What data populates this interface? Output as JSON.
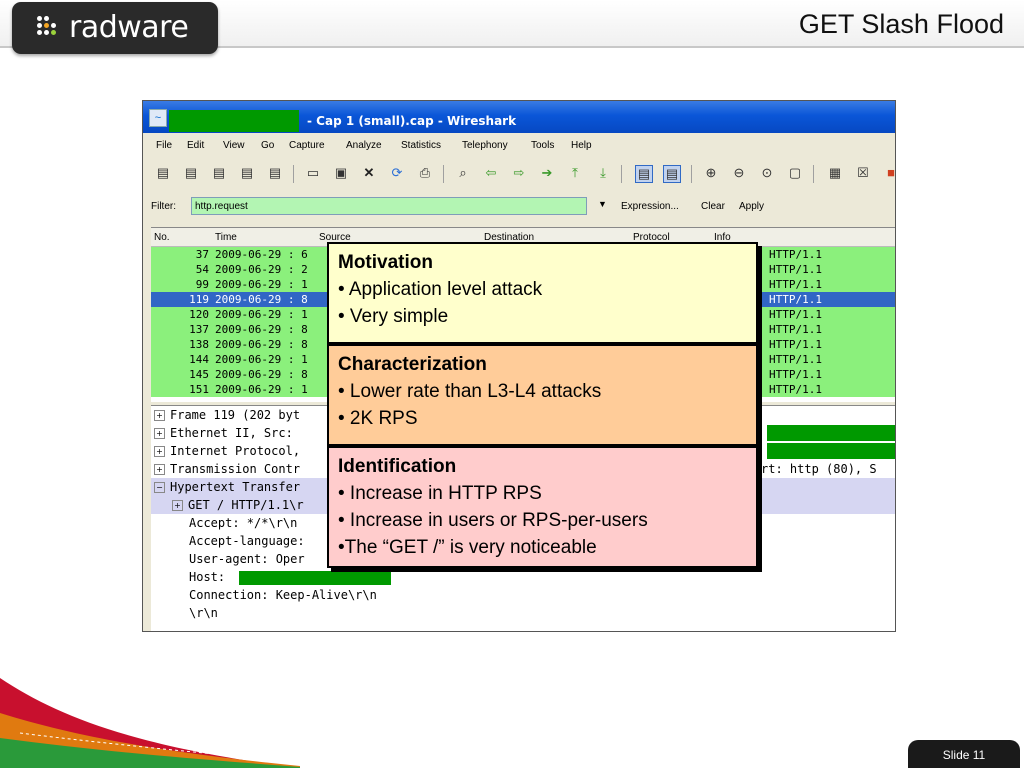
{
  "header": {
    "logo_text": "radware",
    "slide_title": "GET Slash Flood"
  },
  "wireshark": {
    "title": "- Cap 1 (small).cap - Wireshark",
    "menu": [
      "File",
      "Edit",
      "View",
      "Go",
      "Capture",
      "Analyze",
      "Statistics",
      "Telephony",
      "Tools",
      "Help"
    ],
    "filter_label": "Filter:",
    "filter_value": "http.request",
    "expression_label": "Expression...",
    "clear_label": "Clear",
    "apply_label": "Apply",
    "columns": [
      "No.",
      "Time",
      "Source",
      "Destination",
      "Protocol",
      "Info"
    ],
    "packets": [
      {
        "no": "37",
        "time": "2009-06-29 : 6",
        "info": "HTTP/1.1"
      },
      {
        "no": "54",
        "time": "2009-06-29 : 2",
        "info": "HTTP/1.1"
      },
      {
        "no": "99",
        "time": "2009-06-29 : 1",
        "info": "HTTP/1.1"
      },
      {
        "no": "119",
        "time": "2009-06-29 : 8",
        "info": "HTTP/1.1"
      },
      {
        "no": "120",
        "time": "2009-06-29 : 1",
        "info": "HTTP/1.1"
      },
      {
        "no": "137",
        "time": "2009-06-29 : 8",
        "info": "HTTP/1.1"
      },
      {
        "no": "138",
        "time": "2009-06-29 : 8",
        "info": "HTTP/1.1"
      },
      {
        "no": "144",
        "time": "2009-06-29 : 1",
        "info": "HTTP/1.1"
      },
      {
        "no": "145",
        "time": "2009-06-29 : 8",
        "info": "HTTP/1.1"
      },
      {
        "no": "151",
        "time": "2009-06-29 : 1",
        "info": "HTTP/1.1"
      }
    ],
    "selected_packet": "119",
    "details": {
      "frame": "Frame 119 (202 byt",
      "ethernet": "Ethernet II, Src:",
      "ip": "Internet Protocol,",
      "tcp": "Transmission Contr",
      "tcp_tail": "rt: http (80), S",
      "http": "Hypertext Transfer",
      "get": "GET / HTTP/1.1\\r",
      "accept": "Accept: */*\\r\\n",
      "accept_language": "Accept-language:",
      "user_agent": "User-agent: Oper",
      "host": "Host:",
      "connection": "Connection: Keep-Alive\\r\\n",
      "crlf": "\\r\\n"
    }
  },
  "callouts": {
    "motivation": {
      "title": "Motivation",
      "items": [
        "• Application level attack",
        "• Very simple"
      ]
    },
    "characterization": {
      "title": "Characterization",
      "items": [
        "• Lower rate than L3-L4 attacks",
        "• 2K RPS"
      ]
    },
    "identification": {
      "title": "Identification",
      "items": [
        "• Increase in HTTP RPS",
        "• Increase in users or RPS-per-users",
        "•The “GET /” is very noticeable"
      ]
    }
  },
  "footer": {
    "slide_label": "Slide 11"
  },
  "colors": {
    "packet_row": "#8bf07c",
    "selected_row": "#3166c5",
    "redaction": "#009900",
    "motivation_bg": "#ffffcc",
    "characterization_bg": "#ffcc99",
    "identification_bg": "#ffcccc"
  }
}
